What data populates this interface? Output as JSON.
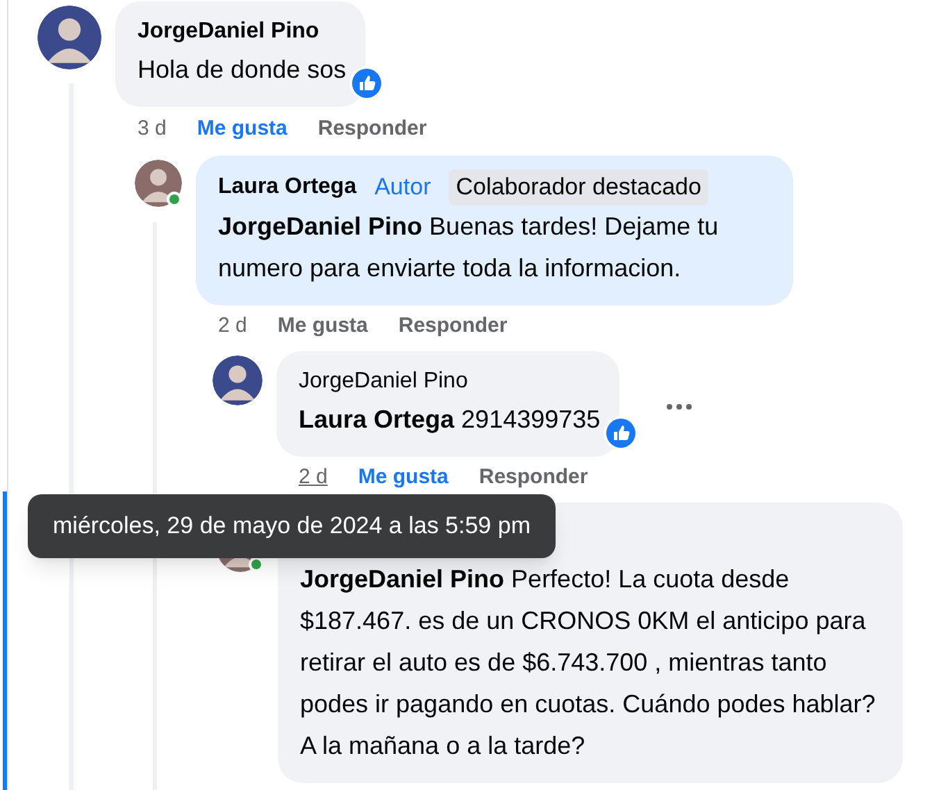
{
  "comments": [
    {
      "author": "JorgeDaniel Pino",
      "text": "Hola de donde sos",
      "reaction": true,
      "highlighted": false,
      "online": false,
      "time": "3 d",
      "time_hovered": false,
      "like": "Me gusta",
      "like_selected": true,
      "reply": "Responder",
      "more": false
    },
    {
      "author": "Laura Ortega",
      "badges": [
        {
          "text": "Autor",
          "kind": "author"
        },
        {
          "text": "Colaborador destacado",
          "kind": "contributor"
        }
      ],
      "text": "**JorgeDaniel Pino** Buenas tardes! Dejame tu numero para enviarte toda la informacion.",
      "reaction": false,
      "highlighted": true,
      "online": true,
      "time": "2 d",
      "time_hovered": false,
      "like": "Me gusta",
      "like_selected": false,
      "reply": "Responder",
      "more": false
    },
    {
      "author": "JorgeDaniel Pino",
      "text": "**Laura Ortega** 2914399735",
      "reaction": true,
      "highlighted": false,
      "online": false,
      "time": "2 d",
      "time_hovered": true,
      "like": "Me gusta",
      "like_selected": true,
      "reply": "Responder",
      "more": true
    },
    {
      "text": "**JorgeDaniel Pino** Perfecto! La cuota desde $187.467. es de un CRONOS 0KM el anticipo para retirar el auto es de $6.743.700 , mientras tanto podes ir pagando en cuotas. Cuándo podes hablar? A la mañana o a la tarde?",
      "reaction": false,
      "highlighted": false,
      "online": true,
      "more": false
    }
  ],
  "tooltip": "miércoles, 29 de mayo de 2024 a las 5:59 pm"
}
